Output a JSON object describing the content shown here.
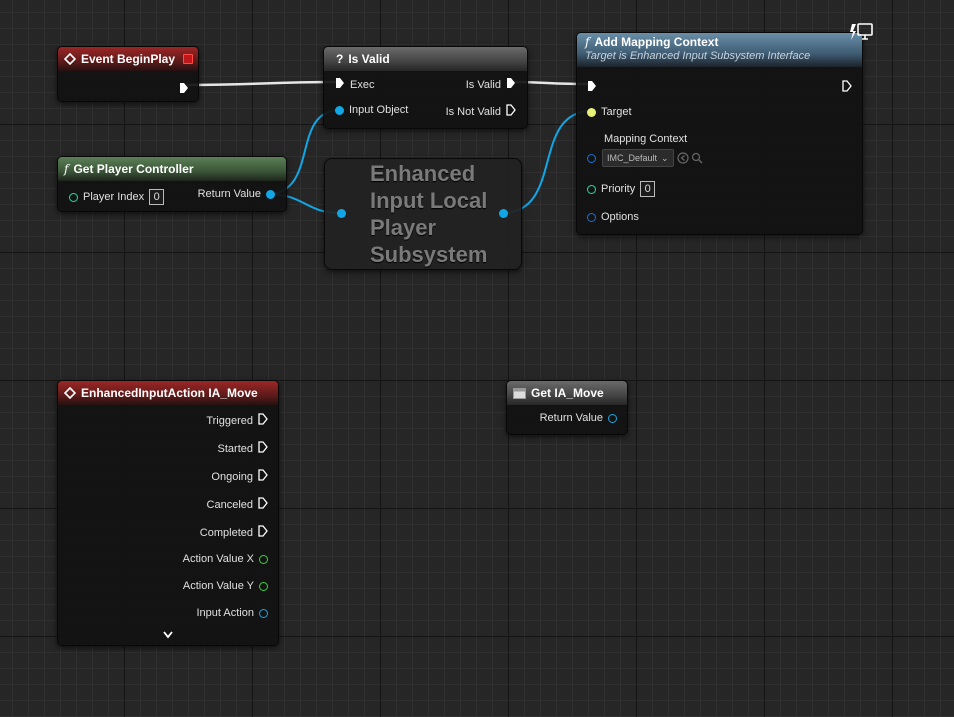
{
  "nodes": {
    "event_begin_play": {
      "title": "Event BeginPlay"
    },
    "is_valid": {
      "title": "Is Valid",
      "exec_label": "Exec",
      "is_valid_label": "Is Valid",
      "input_object_label": "Input Object",
      "is_not_valid_label": "Is Not Valid"
    },
    "add_mapping_context": {
      "title": "Add Mapping Context",
      "subtitle": "Target is Enhanced Input Subsystem Interface",
      "target_label": "Target",
      "mapping_context_label": "Mapping Context",
      "mapping_context_value": "IMC_Default",
      "priority_label": "Priority",
      "priority_value": "0",
      "options_label": "Options"
    },
    "get_player_controller": {
      "title": "Get Player Controller",
      "player_index_label": "Player Index",
      "player_index_value": "0",
      "return_value_label": "Return Value"
    },
    "enhanced_input_subsystem": {
      "title_line1": "Enhanced",
      "title_line2": "Input Local",
      "title_line3": "Player",
      "title_line4": "Subsystem"
    },
    "enhanced_input_action": {
      "title": "EnhancedInputAction IA_Move",
      "triggered": "Triggered",
      "started": "Started",
      "ongoing": "Ongoing",
      "canceled": "Canceled",
      "completed": "Completed",
      "action_value_x": "Action Value X",
      "action_value_y": "Action Value Y",
      "input_action": "Input Action"
    },
    "get_ia_move": {
      "title": "Get IA_Move",
      "return_value_label": "Return Value"
    }
  },
  "colors": {
    "exec": "#ffffff",
    "object_pin": "#11a7e6",
    "int_pin": "#1fe0a0",
    "float_pin": "#38d438",
    "struct_pin": "#1c6fd6",
    "target_pin": "#e8f078"
  }
}
